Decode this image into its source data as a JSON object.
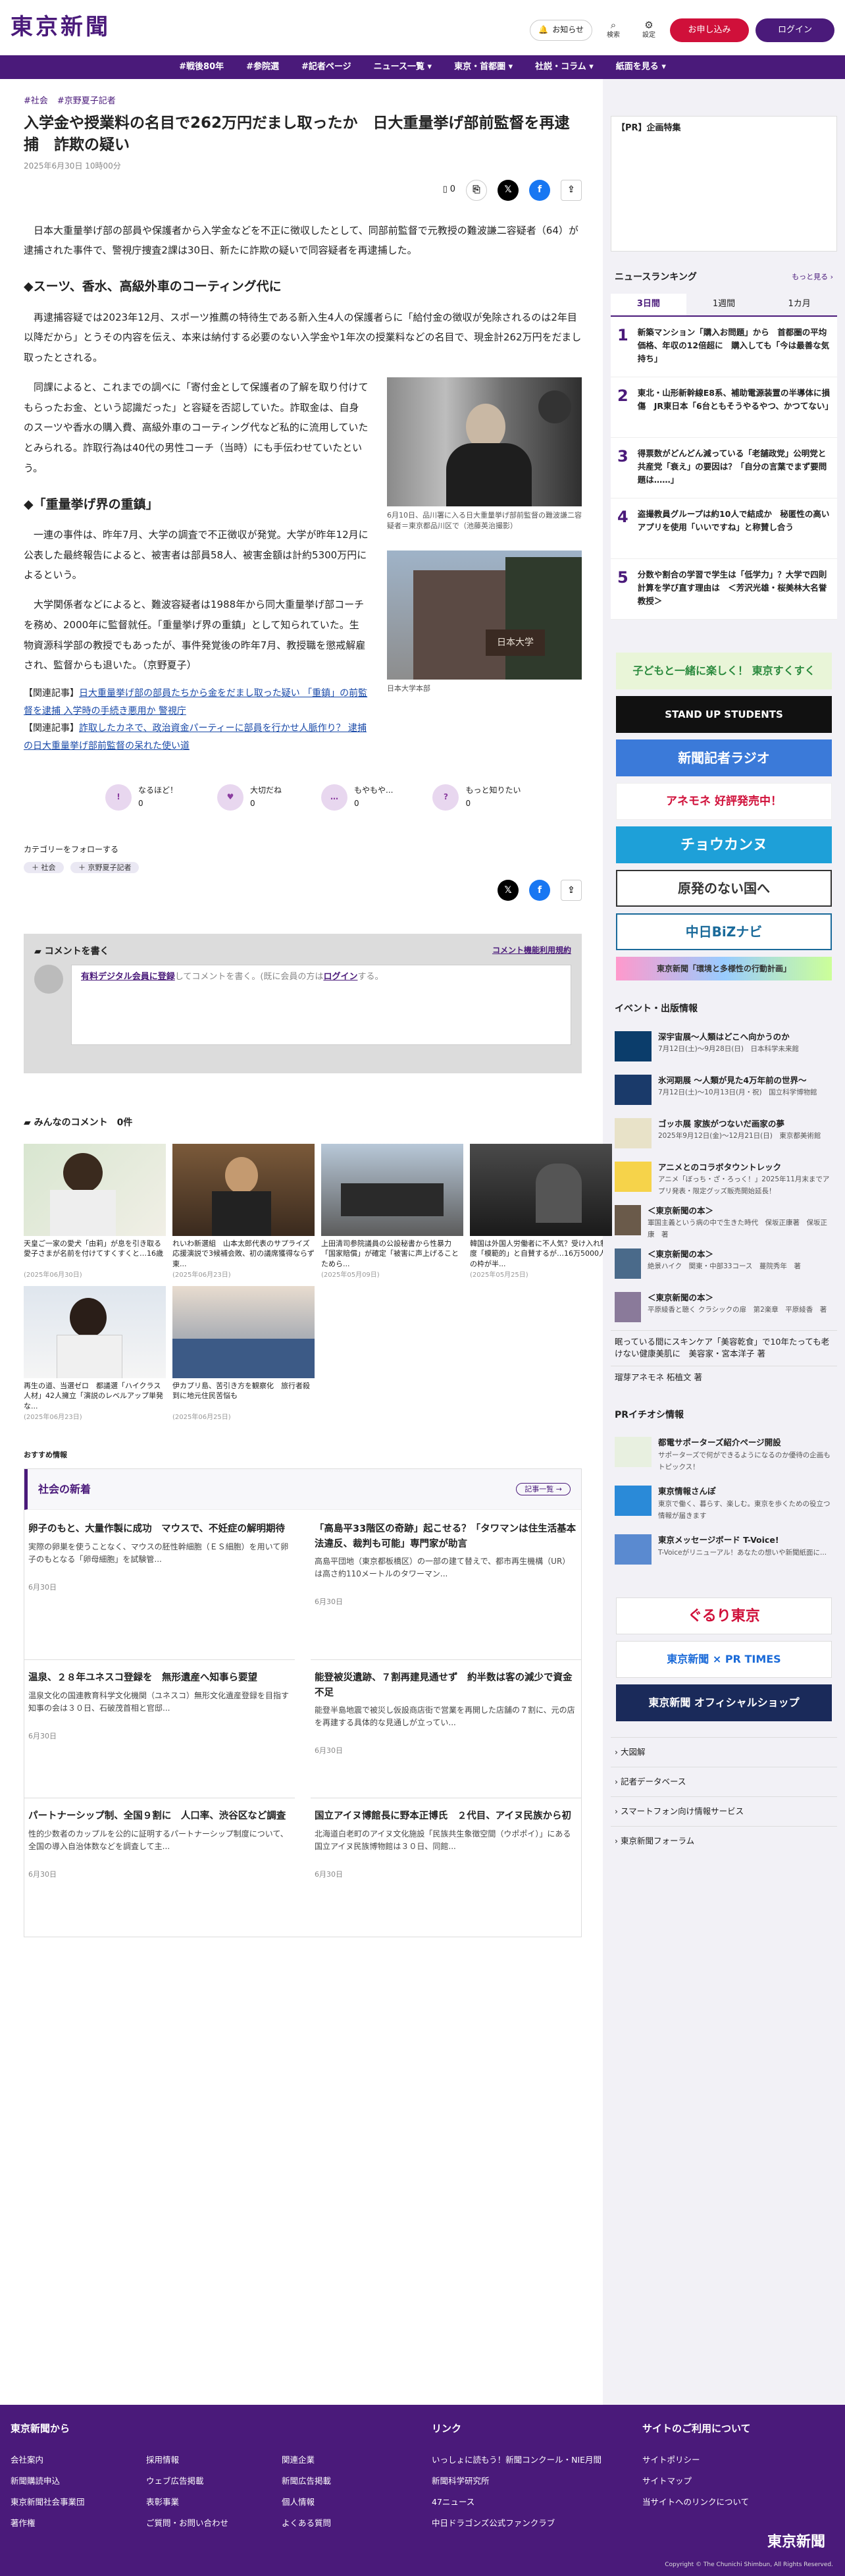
{
  "header": {
    "logo": "東京新聞",
    "notice": "お知らせ",
    "search": "検索",
    "settings": "設定",
    "subscribe": "お申し込み",
    "login": "ログイン"
  },
  "nav": [
    "#戦後80年",
    "#参院選",
    "#記者ページ",
    "ニュース一覧 ▾",
    "東京・首都圏 ▾",
    "社説・コラム ▾",
    "紙面を見る ▾"
  ],
  "article": {
    "tags": [
      "#社会",
      "#京野夏子記者"
    ],
    "title": "入学金や授業料の名目で262万円だまし取ったか　日大重量挙げ部前監督を再逮捕　詐欺の疑い",
    "date": "2025年6月30日 10時00分",
    "bookmark_count": "0",
    "p1": "日本大重量挙げ部の部員や保護者から入学金などを不正に徴収したとして、同部前監督で元教授の難波謙二容疑者（64）が逮捕された事件で、警視庁捜査2課は30日、新たに詐欺の疑いで同容疑者を再逮捕した。",
    "h2a": "◆スーツ、香水、高級外車のコーティング代に",
    "p2": "再逮捕容疑では2023年12月、スポーツ推薦の特待生である新入生4人の保護者らに「給付金の徴収が免除されるのは2年目以降だから」とうその内容を伝え、本来は納付する必要のない入学金や1年次の授業料などの名目で、現金計262万円をだまし取ったとされる。",
    "p3": "同課によると、これまでの調べに「寄付金として保護者の了解を取り付けてもらったお金、という認識だった」と容疑を否認していた。詐取金は、自身のスーツや香水の購入費、高級外車のコーティング代など私的に流用していたとみられる。詐取行為は40代の男性コーチ（当時）にも手伝わせていたという。",
    "h2b": "◆「重量挙げ界の重鎮」",
    "p4": "一連の事件は、昨年7月、大学の調査で不正徴収が発覚。大学が昨年12月に公表した最終報告によると、被害者は部員58人、被害金額は計約5300万円によるという。",
    "p5": "大学関係者などによると、難波容疑者は1988年から同大重量挙げ部コーチを務め、2000年に監督就任。「重量挙げ界の重鎮」として知られていた。生物資源科学部の教授でもあったが、事件発覚後の昨年7月、教授職を懲戒解雇され、監督からも退いた。（京野夏子）",
    "rel1_label": "【関連記事】",
    "rel1": "日大重量挙げ部の部員たちから金をだまし取った疑い 「重鎮」の前監督を逮捕 入学時の手続き悪用か 警視庁",
    "rel2_label": "【関連記事】",
    "rel2": "詐取したカネで、政治資金パーティーに部員を行かせ人脈作り？ 逮捕の日大重量挙げ部前監督の呆れた使い道",
    "cap1": "6月10日、品川署に入る日大重量挙げ部前監督の難波謙二容疑者＝東京都品川区で（池藤英治撮影）",
    "photo2_sign": "日本大学",
    "cap2": "日本大学本部"
  },
  "reactions": [
    {
      "label": "なるほど！",
      "count": "0"
    },
    {
      "label": "大切だね",
      "count": "0"
    },
    {
      "label": "もやもや...",
      "count": "0"
    },
    {
      "label": "もっと知りたい",
      "count": "0"
    }
  ],
  "follow": {
    "label": "カテゴリーをフォローする",
    "chips": [
      "＋ 社会",
      "＋ 京野夏子記者"
    ]
  },
  "comment": {
    "title": "コメントを書く",
    "rules": "コメント機能利用規約",
    "link": "有料デジタル会員に登録",
    "text": "してコメントを書く。(既に会員の方は",
    "login": "ログイン",
    "end": "する。"
  },
  "all_comments": "みんなのコメント　0件",
  "cards": [
    {
      "t": "天皇ご一家の愛犬「由莉」が息を引き取る　愛子さまが名前を付けてすくすくと…16歳",
      "d": "(2025年06月30日)"
    },
    {
      "t": "れいわ新選組　山本太郎代表のサプライズ応援演説で3候補会敗、初の議席獲得ならず　東...",
      "d": "(2025年06月23日)"
    },
    {
      "t": "上田清司参院議員の公設秘書から性暴力「国家賠償」が確定「被害に声上げることためら...",
      "d": "(2025年05月09日)"
    },
    {
      "t": "韓国は外国人労働者に不人気？受け入れ制度「模範的」と自賛するが…16万5000人の枠が半...",
      "d": "(2025年05月25日)"
    },
    {
      "t": "再生の道、当選ゼロ　都議選「ハイクラス人材」42人擁立「演説のレベルアップ単発な...",
      "d": "(2025年06月23日)"
    },
    {
      "t": "伊カプリ島、苦引き方を観察化　旅行者殺到に地元住民苦悩も",
      "d": "(2025年06月25日)"
    }
  ],
  "recommend": "おすすめ情報",
  "local": {
    "title": "社会の新着",
    "more": "記事一覧 →",
    "items": [
      {
        "h": "卵子のもと、大量作製に成功　マウスで、不妊症の解明期待",
        "p": "実際の卵巣を使うことなく、マウスの胚性幹細胞（ＥＳ細胞）を用いて卵子のもとなる「卵母細胞」を試験管...",
        "d": "6月30日"
      },
      {
        "h": "「高島平33階区の奇跡」起こせる？「タワマンは住生活基本法違反、裁判も可能」専門家が助言",
        "p": "高島平団地（東京都板橋区）の一部の建て替えで、都市再生機構（UR）は高さ約110メートルのタワーマン...",
        "d": "6月30日"
      },
      {
        "h": "温泉、２８年ユネスコ登録を　無形遺産へ知事ら要望",
        "p": "温泉文化の国連教育科学文化機関（ユネスコ）無形文化遺産登録を目指す知事の会は３０日、石破茂首相と官邸...",
        "d": "6月30日"
      },
      {
        "h": "能登被災遺跡、７割再建見通せず　約半数は客の減少で資金不足",
        "p": "能登半島地震で被災し仮設商店街で営業を再開した店舗の７割に、元の店を再建する具体的な見通しが立ってい...",
        "d": "6月30日"
      },
      {
        "h": "パートナーシップ制、全国９割に　人口率、渋谷区など調査",
        "p": "性的少数者のカップルを公的に証明するパートナーシップ制度について、全国の導入自治体数などを調査して主...",
        "d": "6月30日"
      },
      {
        "h": "国立アイヌ博館長に野本正博氏　２代目、アイヌ民族から初",
        "p": "北海道白老町のアイヌ文化施設「民族共生象徴空間（ウポポイ）」にある国立アイヌ民族博物館は３０日、同館...",
        "d": "6月30日"
      }
    ]
  },
  "sidebar": {
    "pr": "【PR】企画特集",
    "ranking_title": "ニュースランキング",
    "ranking_more": "もっと見る ›",
    "ranking_tabs": [
      "3日間",
      "1週間",
      "1カ月"
    ],
    "ranking": [
      {
        "n": "1",
        "t": "新築マンション「購入お問題」から　首都圏の平均価格、年収の12倍超に　購入しても「今は最善な気持ち」"
      },
      {
        "n": "2",
        "t": "東北・山形新幹線E8系、補助電源装置の半導体に損傷　JR東日本「6台ともそうやるやつ、かつてない」"
      },
      {
        "n": "3",
        "t": "得票数がどんどん減っている「老舗政党」公明党と共産党「衰え」の要因は？「自分の言葉でまず要問題は……」"
      },
      {
        "n": "4",
        "t": "盗撮教員グループは約10人で結成か　秘匿性の高いアプリを使用「いいですね」と称賛し合う"
      },
      {
        "n": "5",
        "t": "分数や割合の学習で学生は「低学力」？大学で四則計算を学び直す理由は　＜芳沢光雄・桜美林大名誉教授＞"
      }
    ],
    "banners": [
      "子どもと一緒に楽しく！ 東京すくすく",
      "STAND UP STUDENTS",
      "新聞記者ラジオ",
      "アネモネ 好評発売中！",
      "チョウカンヌ",
      "原発のない国へ",
      "中日BiZナビ",
      "東京新聞「環境と多様性の行動計画」"
    ],
    "events_title": "イベント・出版情報",
    "events": [
      {
        "t": "深宇宙展〜人類はどこへ向かうのか",
        "s": "7月12日(土)〜9月28日(日)　日本科学未来館"
      },
      {
        "t": "氷河期展 〜人類が見た4万年前の世界〜",
        "s": "7月12日(土)〜10月13日(月・祝)　国立科学博物館"
      },
      {
        "t": "ゴッホ展 家族がつないだ画家の夢",
        "s": "2025年9月12日(金)〜12月21日(日)　東京都美術館"
      },
      {
        "t": "アニメとのコラボタウントレック",
        "s": "アニメ「ぼっち・ざ・ろっく！」2025年11月末までアプリ発表・限定グッズ販売開始延長！"
      },
      {
        "t": "＜東京新聞の本＞",
        "s": "軍国主義という病の中で生きた時代　保坂正康著　保坂正康　著"
      },
      {
        "t": "＜東京新聞の本＞",
        "s": "絶景ハイク　関東・中部33コース　蔓院秀年　著"
      },
      {
        "t": "＜東京新聞の本＞",
        "s": "平原綾香と聴く クラシックの扉　第2楽章　平原綾香　著"
      }
    ],
    "link1": "眠っている間にスキンケア「美容乾食」で10年たっても老けない健康美肌に　美容家・宮本洋子 著",
    "link2": "瑠芽アネモネ 柘植文 著",
    "prtimes_title": "PRイチオシ情報",
    "prtimes": [
      {
        "t": "都電サポーターズ紹介ページ開設",
        "s": "サポーターズで何ができるようになるのか優待の企画もトピックス！"
      },
      {
        "t": "東京情報さんぽ",
        "s": "東京で働く、暮らす、楽しむ。東京を歩くための役立つ情報が届きます"
      },
      {
        "t": "東京メッセージボード T-Voice!",
        "s": "T-Voiceがリニューアル！あなたの想いや新聞紙面に..."
      }
    ],
    "banners2": [
      "ぐるり東京",
      "東京新聞 × PR TIMES",
      "東京新聞 オフィシャルショップ"
    ],
    "menus": [
      "大図解",
      "記者データベース",
      "スマートフォン向け情報サービス",
      "東京新聞フォーラム"
    ]
  },
  "footer": {
    "col1_title": "東京新聞から",
    "col1a": [
      "会社案内",
      "新聞購読申込",
      "東京新聞社会事業団",
      "著作権"
    ],
    "col1b": [
      "採用情報",
      "ウェブ広告掲載",
      "表彰事業",
      "ご質問・お問い合わせ"
    ],
    "col1c": [
      "関連企業",
      "新聞広告掲載",
      "個人情報",
      "よくある質問"
    ],
    "col2_title": "リンク",
    "col2": [
      "いっしょに読もう！新聞コンクール・NIE月間",
      "新聞科学研究所",
      "47ニュース",
      "中日ドラゴンズ公式ファンクラブ"
    ],
    "col3_title": "サイトのご利用について",
    "col3": [
      "サイトポリシー",
      "サイトマップ",
      "当サイトへのリンクについて"
    ],
    "logo": "東京新聞",
    "copyright": "Copyright © The Chunichi Shimbun, All Rights Reserved."
  }
}
